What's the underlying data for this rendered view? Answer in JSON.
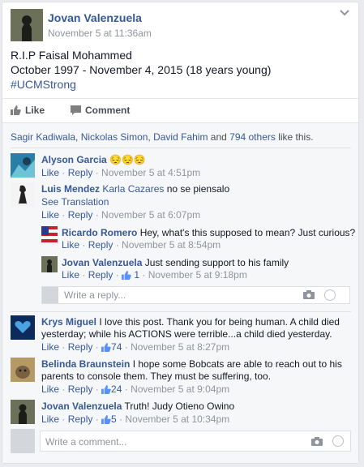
{
  "post": {
    "author": "Jovan Valenzuela",
    "time": "November 5 at 11:36am",
    "line1": "R.I.P Faisal Mohammed",
    "line2": "October 1997 - November 4, 2015 (18 years young)",
    "hashtag": "#UCMStrong"
  },
  "actions": {
    "like": "Like",
    "comment": "Comment"
  },
  "likes": {
    "name1": "Sagir Kadiwala",
    "name2": "Nickolas Simon",
    "name3": "David Fahim",
    "and": " and ",
    "others": "794 others",
    "suffix": " like this.",
    "comma": ", "
  },
  "comments": [
    {
      "name": "Alyson Garcia",
      "text": "😔😔😔",
      "like": "Like",
      "reply": "Reply",
      "time": "November 5 at 4:51pm"
    },
    {
      "name": "Luis Mendez",
      "tag": "Karla Cazares",
      "text": " no se piensalo",
      "translate": "See Translation",
      "like": "Like",
      "reply": "Reply",
      "time": "November 5 at 6:07pm"
    },
    {
      "name": "Ricardo Romero",
      "text": " Hey, what's this supposed to mean? Just curious?",
      "like": "Like",
      "reply": "Reply",
      "time": "November 5 at 8:54pm"
    },
    {
      "name": "Jovan Valenzuela",
      "text": " Just sending support to his family",
      "like": "Like",
      "reply": "Reply",
      "likes": "1",
      "time": "November 5 at 9:18pm"
    },
    {
      "name": "Krys Miguel",
      "text1": " I love this post. Thank you for being human. A child died",
      "text2": "yesterday; while his ACTIONS were terrible...a child died yesterday.",
      "like": "Like",
      "reply": "Reply",
      "likes": "74",
      "time": "November 5 at 8:27pm"
    },
    {
      "name": "Belinda Braunstein",
      "text1": " I hope some Bobcats are able to reach out to his",
      "text2": "parents to console them. They must be suffering, too.",
      "like": "Like",
      "reply": "Reply",
      "likes": "24",
      "time": "November 5 at 9:04pm"
    },
    {
      "name": "Jovan Valenzuela",
      "text": " Truth! Judy Otieno Owino",
      "like": "Like",
      "reply": "Reply",
      "likes": "5",
      "time": "November 5 at 10:34pm"
    }
  ],
  "reply_placeholder": "Write a reply...",
  "comment_placeholder": "Write a comment...",
  "separator": " · "
}
